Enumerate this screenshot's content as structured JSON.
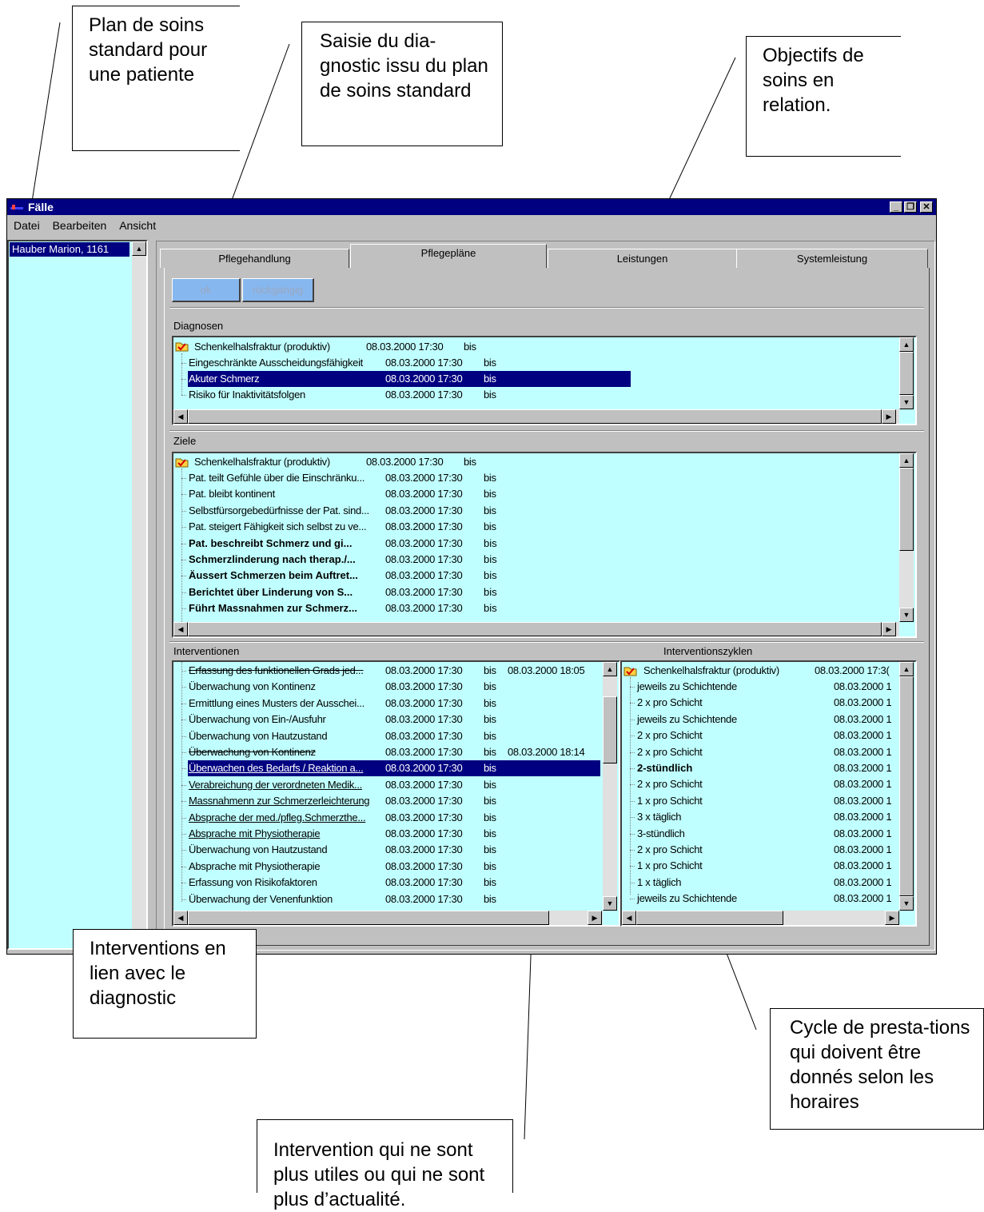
{
  "callouts": {
    "plan": "Plan de soins standard pour une patiente",
    "saisie": "Saisie du dia-gnostic issu du plan de soins standard",
    "objectifs": "Objectifs de soins en relation.",
    "interventions": "Interventions en lien avec le diagnostic",
    "cycle": "Cycle de presta-tions qui doivent être donnés selon les horaires",
    "plus_utiles": "Intervention qui ne sont plus utiles ou qui ne sont plus d’actualité."
  },
  "window": {
    "title": "Fälle",
    "menu": [
      "Datei",
      "Bearbeiten",
      "Ansicht"
    ],
    "patient": "Hauber Marion, 1161"
  },
  "tabs": [
    "Pflegehandlung",
    "Pflegepläne",
    "Leistungen",
    "Systemleistung"
  ],
  "buttons": {
    "ok": "ok",
    "undo": "rückgängig"
  },
  "diagnosen": {
    "label": "Diagnosen",
    "root": {
      "name": "Schenkelhalsfraktur (produktiv)",
      "date": "08.03.2000 17:30",
      "bis": "bis"
    },
    "rows": [
      {
        "name": "Eingeschränkte Ausscheidungsfähigkeit",
        "date": "08.03.2000 17:30",
        "bis": "bis"
      },
      {
        "name": "Akuter Schmerz",
        "date": "08.03.2000 17:30",
        "bis": "bis"
      },
      {
        "name": "Risiko für Inaktivitätsfolgen",
        "date": "08.03.2000 17:30",
        "bis": "bis"
      }
    ]
  },
  "ziele": {
    "label": "Ziele",
    "root": {
      "name": "Schenkelhalsfraktur (produktiv)",
      "date": "08.03.2000 17:30",
      "bis": "bis"
    },
    "rows": [
      {
        "name": "Pat. teilt Gefühle über die Einschränku...",
        "date": "08.03.2000 17:30",
        "bis": "bis"
      },
      {
        "name": "Pat. bleibt kontinent",
        "date": "08.03.2000 17:30",
        "bis": "bis"
      },
      {
        "name": "Selbstfürsorgebedürfnisse der Pat. sind...",
        "date": "08.03.2000 17:30",
        "bis": "bis"
      },
      {
        "name": "Pat. steigert Fähigkeit sich selbst zu ve...",
        "date": "08.03.2000 17:30",
        "bis": "bis"
      },
      {
        "name": "Pat. beschreibt Schmerz und gi...",
        "date": "08.03.2000 17:30",
        "bis": "bis"
      },
      {
        "name": "Schmerzlinderung nach therap./...",
        "date": "08.03.2000 17:30",
        "bis": "bis"
      },
      {
        "name": "Äussert Schmerzen beim Auftret...",
        "date": "08.03.2000 17:30",
        "bis": "bis"
      },
      {
        "name": "Berichtet über Linderung von S...",
        "date": "08.03.2000 17:30",
        "bis": "bis"
      },
      {
        "name": "Führt Massnahmen zur Schmerz...",
        "date": "08.03.2000 17:30",
        "bis": "bis"
      }
    ]
  },
  "interventionen": {
    "label": "Interventionen",
    "rows": [
      {
        "name": "Erfassung des funktionellen Grads jed...",
        "date": "08.03.2000 17:30",
        "bis": "bis",
        "end": "08.03.2000 18:05"
      },
      {
        "name": "Überwachung von Kontinenz",
        "date": "08.03.2000 17:30",
        "bis": "bis",
        "end": ""
      },
      {
        "name": "Ermittlung eines Musters der Ausschei...",
        "date": "08.03.2000 17:30",
        "bis": "bis",
        "end": ""
      },
      {
        "name": "Überwachung von Ein-/Ausfuhr",
        "date": "08.03.2000 17:30",
        "bis": "bis",
        "end": ""
      },
      {
        "name": "Überwachung von Hautzustand",
        "date": "08.03.2000 17:30",
        "bis": "bis",
        "end": ""
      },
      {
        "name": "Überwachung von Kontinenz",
        "date": "08.03.2000 17:30",
        "bis": "bis",
        "end": "08.03.2000 18:14"
      },
      {
        "name": "Überwachen des Bedarfs / Reaktion a...",
        "date": "08.03.2000 17:30",
        "bis": "bis",
        "end": ""
      },
      {
        "name": "Verabreichung der verordneten Medik...",
        "date": "08.03.2000 17:30",
        "bis": "bis",
        "end": ""
      },
      {
        "name": "Massnahmenn zur Schmerzerleichterung",
        "date": "08.03.2000 17:30",
        "bis": "bis",
        "end": ""
      },
      {
        "name": "Absprache der med./pfleg.Schmerzthe...",
        "date": "08.03.2000 17:30",
        "bis": "bis",
        "end": ""
      },
      {
        "name": "Absprache mit Physiotherapie",
        "date": "08.03.2000 17:30",
        "bis": "bis",
        "end": ""
      },
      {
        "name": "Überwachung von Hautzustand",
        "date": "08.03.2000 17:30",
        "bis": "bis",
        "end": ""
      },
      {
        "name": "Absprache mit Physiotherapie",
        "date": "08.03.2000 17:30",
        "bis": "bis",
        "end": ""
      },
      {
        "name": "Erfassung von Risikofaktoren",
        "date": "08.03.2000 17:30",
        "bis": "bis",
        "end": ""
      },
      {
        "name": "Überwachung der Venenfunktion",
        "date": "08.03.2000 17:30",
        "bis": "bis",
        "end": ""
      }
    ]
  },
  "zyklen": {
    "label": "Interventionszyklen",
    "root": {
      "name": "Schenkelhalsfraktur (produktiv)",
      "date": "08.03.2000 17:3("
    },
    "rows": [
      {
        "name": "jeweils zu Schichtende",
        "date": "08.03.2000 1"
      },
      {
        "name": "2 x pro Schicht",
        "date": "08.03.2000 1"
      },
      {
        "name": "jeweils zu Schichtende",
        "date": "08.03.2000 1"
      },
      {
        "name": "2 x pro Schicht",
        "date": "08.03.2000 1"
      },
      {
        "name": "2 x pro Schicht",
        "date": "08.03.2000 1"
      },
      {
        "name": "2-stündlich",
        "date": "08.03.2000 1"
      },
      {
        "name": "2 x pro Schicht",
        "date": "08.03.2000 1"
      },
      {
        "name": "1 x pro Schicht",
        "date": "08.03.2000 1"
      },
      {
        "name": "3 x täglich",
        "date": "08.03.2000 1"
      },
      {
        "name": "3-stündlich",
        "date": "08.03.2000 1"
      },
      {
        "name": "2 x pro Schicht",
        "date": "08.03.2000 1"
      },
      {
        "name": "1 x pro Schicht",
        "date": "08.03.2000 1"
      },
      {
        "name": "1 x täglich",
        "date": "08.03.2000 1"
      },
      {
        "name": "jeweils zu Schichtende",
        "date": "08.03.2000 1"
      }
    ]
  },
  "colors": {
    "titlebar": "#000080",
    "list_bg": "#c0ffff",
    "selection": "#000080",
    "button": "#87b7ef"
  }
}
